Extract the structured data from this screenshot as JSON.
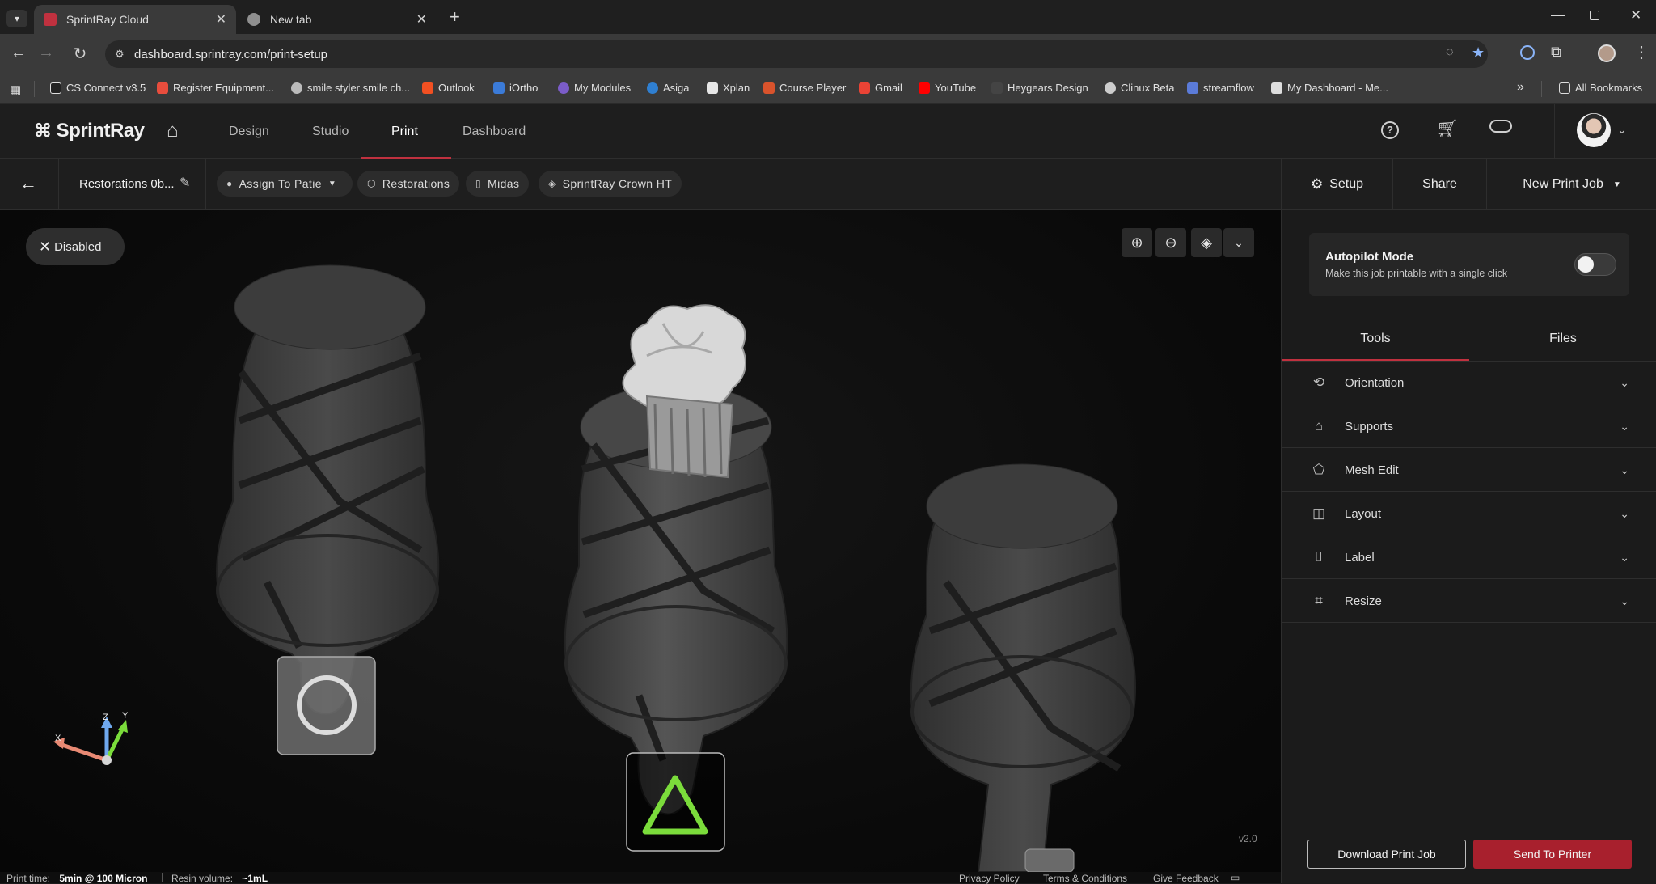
{
  "browser": {
    "tabs": [
      {
        "title": "SprintRay Cloud",
        "favicon_color": "#c0313f"
      },
      {
        "title": "New tab",
        "favicon_color": "#9a9a9a"
      }
    ],
    "url": "dashboard.sprintray.com/print-setup",
    "bookmarks": [
      {
        "label": "CS Connect v3.5",
        "color": "#e0e0e0"
      },
      {
        "label": "Register Equipment...",
        "color": "#e84d3d"
      },
      {
        "label": "smile styler smile ch...",
        "color": "#cccccc"
      },
      {
        "label": "Outlook",
        "color": "#f25022"
      },
      {
        "label": "iOrtho",
        "color": "#3b7bd8"
      },
      {
        "label": "My Modules",
        "color": "#7b5cc9"
      },
      {
        "label": "Asiga",
        "color": "#2f7fd1"
      },
      {
        "label": "Xplan",
        "color": "#e6e6e6"
      },
      {
        "label": "Course Player",
        "color": "#d9532c"
      },
      {
        "label": "Gmail",
        "color": "#ea4335"
      },
      {
        "label": "YouTube",
        "color": "#ff0000"
      },
      {
        "label": "Heygears Design",
        "color": "#444444"
      },
      {
        "label": "Clinux Beta",
        "color": "#cccccc"
      },
      {
        "label": "streamflow",
        "color": "#5b7bd8"
      },
      {
        "label": "My Dashboard - Me...",
        "color": "#dddddd"
      }
    ],
    "all_bookmarks": "All Bookmarks",
    "overflow": "»"
  },
  "app": {
    "brand": "SprintRay",
    "nav": [
      "Design",
      "Studio",
      "Print",
      "Dashboard"
    ],
    "active_nav": "Print",
    "accent": "#c0313f"
  },
  "toolbar": {
    "job_name": "Restorations 0b...",
    "chips": [
      {
        "label": "Assign To Patie",
        "icon": "person-icon"
      },
      {
        "label": "Restorations",
        "icon": "cube-icon"
      },
      {
        "label": "Midas",
        "icon": "printer-icon"
      },
      {
        "label": "SprintRay Crown HT",
        "icon": "resin-icon"
      }
    ],
    "setup": "Setup",
    "share": "Share",
    "new_print_job": "New Print Job"
  },
  "viewport": {
    "disabled_label": "Disabled",
    "version": "v2.0",
    "axes": {
      "x": "X",
      "y": "Y",
      "z": "Z"
    }
  },
  "panel": {
    "autopilot_title": "Autopilot Mode",
    "autopilot_desc": "Make this job printable with a single click",
    "autopilot_on": false,
    "tabs": [
      "Tools",
      "Files"
    ],
    "active_tab": "Tools",
    "sections": [
      {
        "label": "Orientation",
        "icon": "orientation-icon"
      },
      {
        "label": "Supports",
        "icon": "supports-icon"
      },
      {
        "label": "Mesh Edit",
        "icon": "mesh-edit-icon"
      },
      {
        "label": "Layout",
        "icon": "layout-icon"
      },
      {
        "label": "Label",
        "icon": "label-icon"
      },
      {
        "label": "Resize",
        "icon": "crop-icon"
      }
    ],
    "download": "Download Print Job",
    "send": "Send To Printer"
  },
  "status": {
    "print_time_label": "Print time:",
    "print_time_value": "5min @ 100 Micron",
    "resin_label": "Resin volume:",
    "resin_value": "~1mL",
    "links": [
      "Privacy Policy",
      "Terms & Conditions",
      "Give Feedback"
    ]
  }
}
